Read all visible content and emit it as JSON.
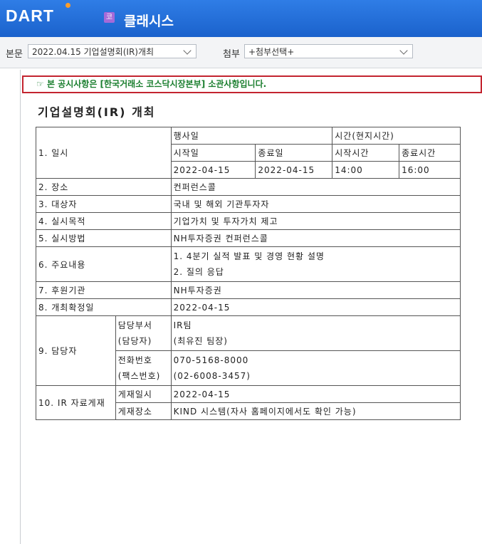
{
  "header": {
    "logo": "DART",
    "corp_badge": "코",
    "corp_name": "클래시스"
  },
  "toolbar": {
    "body_label": "본문",
    "body_select": "2022.04.15  기업설명회(IR)개최",
    "attach_label": "첨부",
    "attach_select": "+첨부선택+"
  },
  "notice": "본 공시사항은 [한국거래소 코스닥시장본부] 소관사항입니다.",
  "doc_title": "기업설명회(IR) 개최",
  "table": {
    "r1_label": "1. 일시",
    "event_date": "행사일",
    "time_local": "시간(현지시간)",
    "start_date_h": "시작일",
    "end_date_h": "종료일",
    "start_time_h": "시작시간",
    "end_time_h": "종료시간",
    "start_date": "2022-04-15",
    "end_date": "2022-04-15",
    "start_time": "14:00",
    "end_time": "16:00",
    "r2_label": "2. 장소",
    "r2_value": "컨퍼런스콜",
    "r3_label": "3. 대상자",
    "r3_value": "국내 및 해외 기관투자자",
    "r4_label": "4. 실시목적",
    "r4_value": "기업가치 및 투자가치 제고",
    "r5_label": "5. 실시방법",
    "r5_value": "NH투자증권 컨퍼런스콜",
    "r6_label": "6. 주요내용",
    "r6_value1": "1. 4분기 실적 발표 및 경영 현황 설명",
    "r6_value2": "2. 질의 응답",
    "r7_label": "7. 후원기관",
    "r7_value": "NH투자증권",
    "r8_label": "8. 개최확정일",
    "r8_value": "2022-04-15",
    "r9_label": "9. 담당자",
    "dept_label1": "담당부서",
    "dept_label2": "(담당자)",
    "dept_value1": "IR팀",
    "dept_value2": "(최유진 팀장)",
    "phone_label1": "전화번호",
    "phone_label2": "(팩스번호)",
    "phone_value1": "070-5168-8000",
    "phone_value2": "(02-6008-3457)",
    "r10_label": "10. IR 자료게재",
    "post_date_label": "게재일시",
    "post_date_value": "2022-04-15",
    "post_place_label": "게재장소",
    "post_place_value": "KIND 시스템(자사 홈페이지에서도 확인 가능)"
  }
}
